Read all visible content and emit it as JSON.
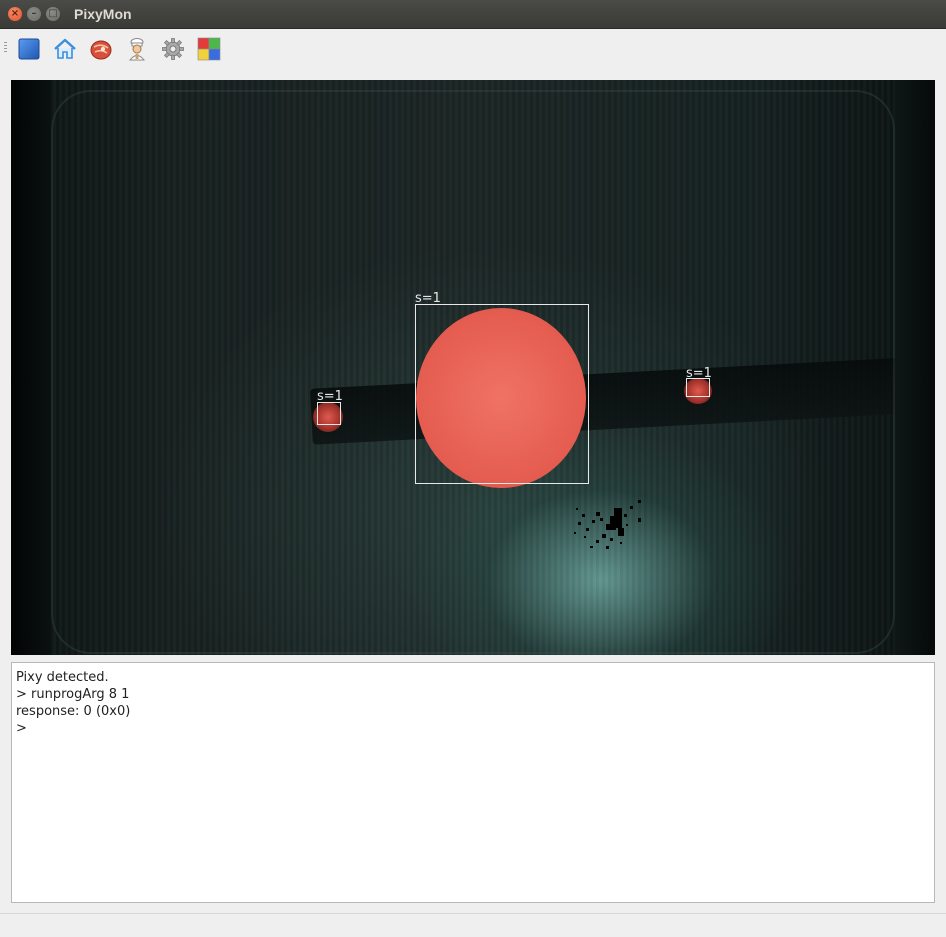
{
  "window": {
    "title": "PixyMon",
    "controls": [
      "close-icon",
      "minimize-icon",
      "maximize-icon"
    ]
  },
  "toolbar": {
    "buttons": [
      {
        "icon": "stop-icon",
        "color": "#2f6fc8"
      },
      {
        "icon": "home-icon",
        "color": "#3a8ee0"
      },
      {
        "icon": "raw-video-icon",
        "color": "#d8503a"
      },
      {
        "icon": "chef-icon",
        "color": "#c9a46a"
      },
      {
        "icon": "gear-icon",
        "color": "#9a9a9a"
      },
      {
        "icon": "color-signatures-icon",
        "colors": [
          "#e33b3b",
          "#4cb84c",
          "#f0d23a",
          "#3b6be0"
        ]
      }
    ]
  },
  "camera": {
    "blocks": [
      {
        "label": "s=1"
      },
      {
        "label": "s=1"
      },
      {
        "label": "s=1"
      }
    ]
  },
  "console": {
    "lines": [
      "Pixy detected.",
      "> runprogArg 8 1",
      "response: 0 (0x0)",
      ">"
    ]
  }
}
